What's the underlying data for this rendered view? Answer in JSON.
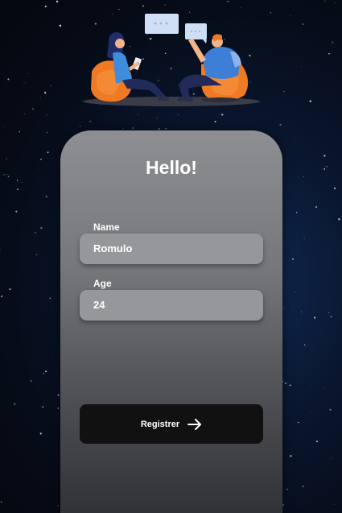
{
  "illustration": {
    "name": "two people chatting on bean bags"
  },
  "form": {
    "title": "Hello!",
    "name_label": "Name",
    "name_value": "Romulo",
    "age_label": "Age",
    "age_value": "24",
    "submit_label": "Registrer",
    "submit_icon": "arrow-right-icon"
  },
  "colors": {
    "background": "#060c18",
    "card_top": "#8e8f93",
    "card_bottom": "#2e2f34",
    "button": "#111111",
    "text": "#ffffff"
  }
}
